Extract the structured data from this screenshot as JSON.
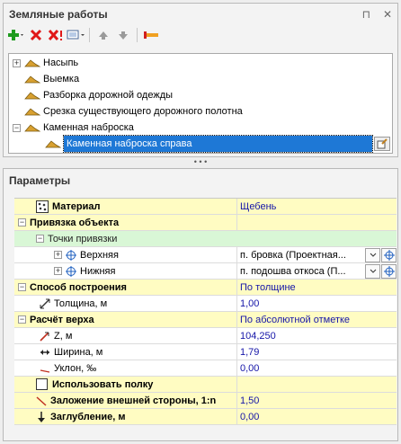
{
  "earthworks": {
    "title": "Земляные работы",
    "pin_glyph": "⊓",
    "close_glyph": "✕",
    "tree": [
      {
        "label": "Насыпь"
      },
      {
        "label": "Выемка"
      },
      {
        "label": "Разборка дорожной одежды"
      },
      {
        "label": "Срезка существующего дорожного полотна"
      },
      {
        "label": "Каменная наброска"
      },
      {
        "label": "Каменная наброска справа"
      }
    ]
  },
  "params": {
    "title": "Параметры",
    "rows": [
      {
        "label": "Материал",
        "value": "Щебень"
      },
      {
        "label": "Привязка объекта",
        "value": ""
      },
      {
        "label": "Точки привязки",
        "value": ""
      },
      {
        "label": "Верхняя",
        "value": "п. бровка (Проектная..."
      },
      {
        "label": "Нижняя",
        "value": "п. подошва откоса (П..."
      },
      {
        "label": "Способ построения",
        "value": "По толщине"
      },
      {
        "label": "Толщина, м",
        "value": "1,00"
      },
      {
        "label": "Расчёт верха",
        "value": "По абсолютной отметке"
      },
      {
        "label": "Z, м",
        "value": "104,250"
      },
      {
        "label": "Ширина, м",
        "value": "1,79"
      },
      {
        "label": "Уклон, ‰",
        "value": "0,00"
      },
      {
        "label": "Использовать полку",
        "value": ""
      },
      {
        "label": "Заложение внешней стороны, 1:n",
        "value": "1,50"
      },
      {
        "label": "Заглубление, м",
        "value": "0,00"
      }
    ]
  },
  "colors": {
    "category_bg": "#fffcc2",
    "subgroup_bg": "#d9f7d6",
    "selection": "#1e78d6",
    "value_text": "#1515a8"
  }
}
